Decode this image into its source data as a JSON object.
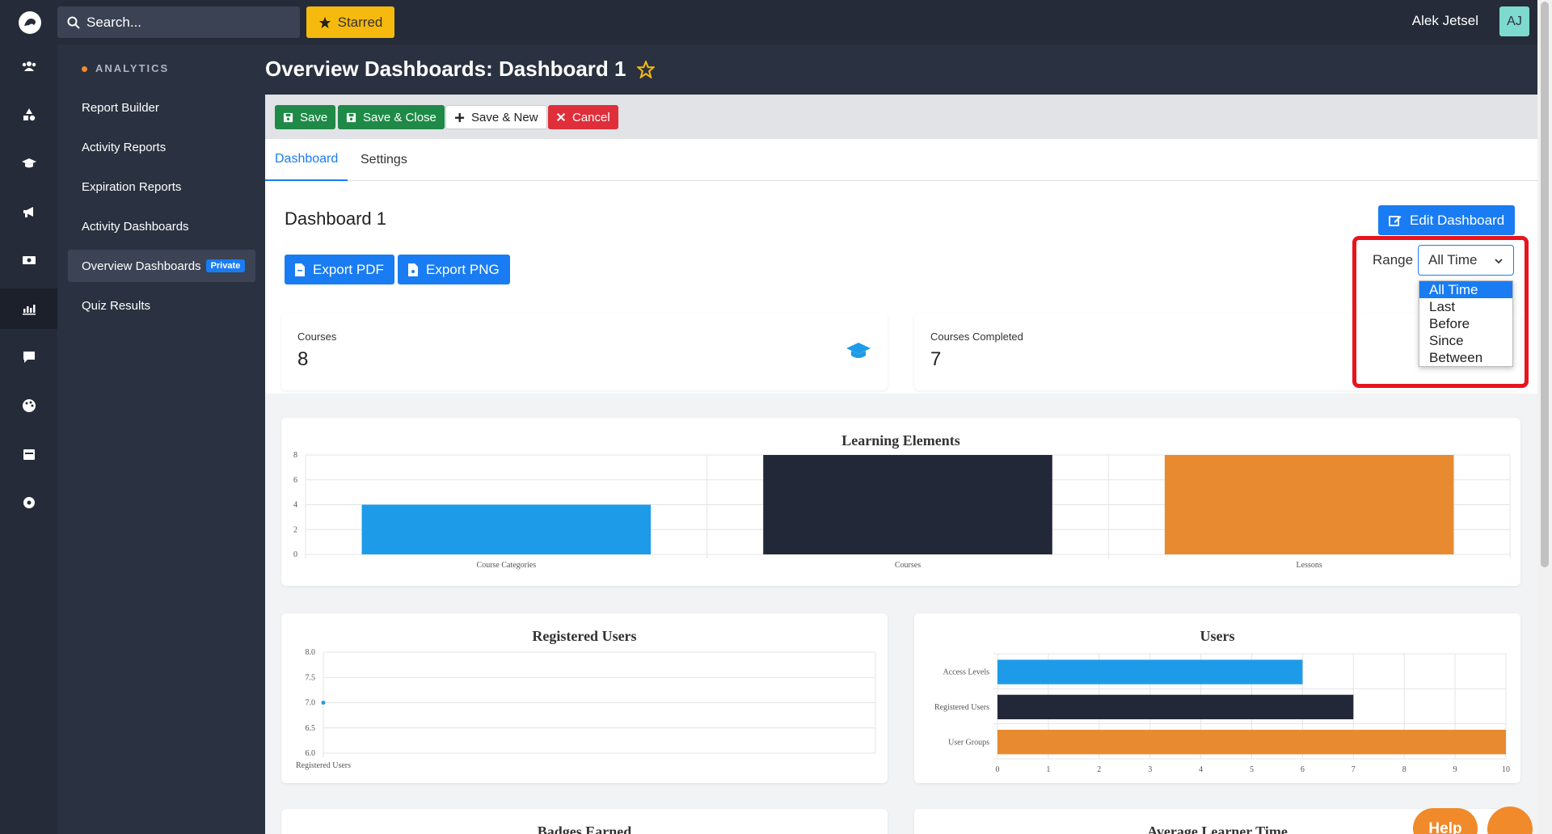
{
  "topbar": {
    "search_placeholder": "Search...",
    "starred_label": "Starred",
    "user_name": "Alek Jetsel",
    "user_initials": "AJ"
  },
  "rail": {
    "icons": [
      "users-icon",
      "shapes-icon",
      "graduation-cap-icon",
      "megaphone-icon",
      "money-icon",
      "chart-icon",
      "chat-icon",
      "palette-icon",
      "calendar-icon",
      "gear-icon"
    ],
    "active": "chart-icon"
  },
  "submenu": {
    "heading": "ANALYTICS",
    "items": [
      {
        "label": "Report Builder"
      },
      {
        "label": "Activity Reports"
      },
      {
        "label": "Expiration Reports"
      },
      {
        "label": "Activity Dashboards"
      },
      {
        "label": "Overview Dashboards",
        "badge": "Private"
      },
      {
        "label": "Quiz Results"
      }
    ]
  },
  "header": {
    "title": "Overview Dashboards: Dashboard 1"
  },
  "toolbar": {
    "save": "Save",
    "save_close": "Save & Close",
    "save_new": "Save & New",
    "cancel": "Cancel"
  },
  "tabs": [
    {
      "label": "Dashboard"
    },
    {
      "label": "Settings"
    }
  ],
  "dashboard": {
    "title": "Dashboard 1",
    "edit_button": "Edit Dashboard",
    "export_pdf": "Export PDF",
    "export_png": "Export PNG",
    "range_label": "Range",
    "range_value": "All Time",
    "range_options": [
      "All Time",
      "Last",
      "Before",
      "Since",
      "Between"
    ]
  },
  "stats": [
    {
      "label": "Courses",
      "value": "8"
    },
    {
      "label": "Courses Completed",
      "value": "7"
    }
  ],
  "colors": {
    "blue": "#1e9be8",
    "navy": "#222837",
    "orange": "#e88a2f",
    "accent": "#1a7cf2"
  },
  "chart_data": [
    {
      "type": "bar",
      "title": "Learning Elements",
      "categories": [
        "Course Categories",
        "Courses",
        "Lessons"
      ],
      "values": [
        4,
        8,
        8
      ],
      "ylim": [
        0,
        8
      ],
      "yticks": [
        "0",
        "2",
        "4",
        "6",
        "8"
      ]
    },
    {
      "type": "scatter",
      "title": "Registered Users",
      "categories": [
        "Registered Users"
      ],
      "values": [
        7
      ],
      "ylim": [
        6,
        8
      ],
      "yticks": [
        "6.0",
        "6.5",
        "7.0",
        "7.5",
        "8.0"
      ]
    },
    {
      "type": "bar",
      "orientation": "horizontal",
      "title": "Users",
      "categories": [
        "Access Levels",
        "Registered Users",
        "User Groups"
      ],
      "values": [
        6,
        7,
        10
      ],
      "xlim": [
        0,
        10
      ],
      "xticks": [
        "0",
        "1",
        "2",
        "3",
        "4",
        "5",
        "6",
        "7",
        "8",
        "9",
        "10"
      ]
    }
  ],
  "partial_titles": {
    "left": "Badges Earned",
    "right": "Average Learner Time"
  },
  "help_label": "Help"
}
